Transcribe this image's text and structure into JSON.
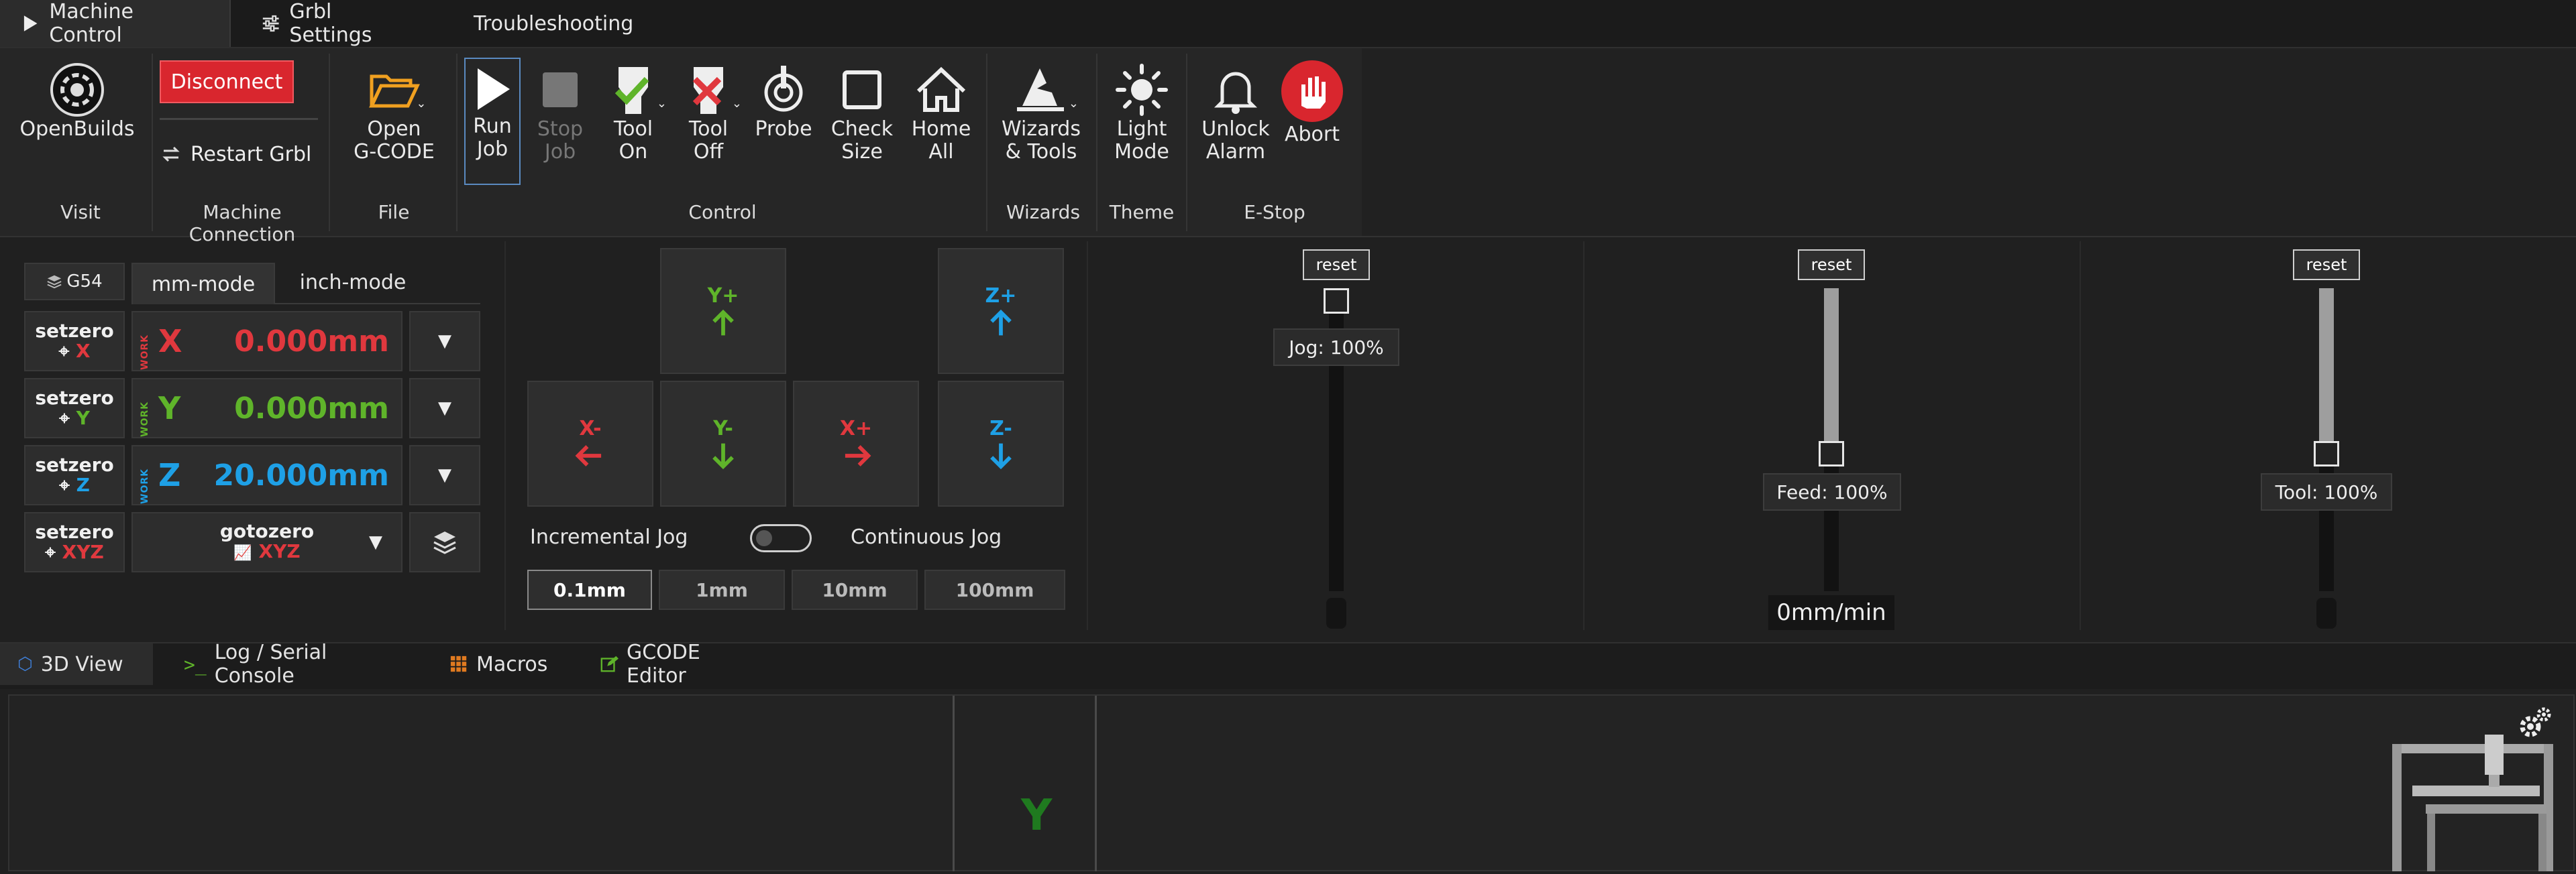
{
  "top_tabs": [
    {
      "label": "Machine Control",
      "icon": "play-icon"
    },
    {
      "label": "Grbl Settings",
      "icon": "sliders-icon"
    },
    {
      "label": "Troubleshooting",
      "icon": "document-icon"
    }
  ],
  "ribbon": {
    "openbuilds_label": "OpenBuilds",
    "disconnect_label": "Disconnect",
    "restart_label": "Restart Grbl",
    "open_gcode": [
      "Open",
      "G-CODE"
    ],
    "run_job": [
      "Run",
      "Job"
    ],
    "stop_job": [
      "Stop",
      "Job"
    ],
    "tool_on": [
      "Tool",
      "On"
    ],
    "tool_off": [
      "Tool",
      "Off"
    ],
    "probe": "Probe",
    "check_size": [
      "Check",
      "Size"
    ],
    "home_all": [
      "Home",
      "All"
    ],
    "wizards": [
      "Wizards",
      "& Tools"
    ],
    "light_mode": [
      "Light",
      "Mode"
    ],
    "unlock_alarm": [
      "Unlock",
      "Alarm"
    ],
    "abort": "Abort",
    "groups": {
      "visit": "Visit",
      "machine_connection": "Machine Connection",
      "file": "File",
      "control": "Control",
      "wizards": "Wizards",
      "theme": "Theme",
      "estop": "E-Stop"
    }
  },
  "dro": {
    "wcs_label": "G54",
    "mode_tabs": [
      "mm-mode",
      "inch-mode"
    ],
    "setzero_label": "setzero",
    "work_label": "WORK",
    "axes": [
      {
        "letter": "X",
        "value": "0.000mm",
        "setzero_axis": "X"
      },
      {
        "letter": "Y",
        "value": "0.000mm",
        "setzero_axis": "Y"
      },
      {
        "letter": "Z",
        "value": "20.000mm",
        "setzero_axis": "Z"
      }
    ],
    "setzero_xyz": "XYZ",
    "gotozero_label": "gotozero",
    "gotozero_axes": "XYZ"
  },
  "jog": {
    "y_plus": "Y+",
    "y_minus": "Y-",
    "x_plus": "X+",
    "x_minus": "X-",
    "z_plus": "Z+",
    "z_minus": "Z-",
    "incremental_label": "Incremental Jog",
    "continuous_label": "Continuous Jog",
    "steps": [
      "0.1mm",
      "1mm",
      "10mm",
      "100mm"
    ],
    "active_step": "0.1mm"
  },
  "sliders": {
    "reset_label": "reset",
    "jog_label": "Jog: 100%",
    "jog_level": 0,
    "feed_label": "Feed: 100%",
    "feed_level": 0.55,
    "feed_rate": "0mm/min",
    "tool_label": "Tool: 100%",
    "tool_level": 0.55
  },
  "bottom_tabs": [
    {
      "label": "3D View",
      "icon": "cube-icon"
    },
    {
      "label": "Log / Serial Console",
      "icon": "terminal-icon"
    },
    {
      "label": "Macros",
      "icon": "grid-icon"
    },
    {
      "label": "GCODE Editor",
      "icon": "edit-icon"
    }
  ],
  "viewer": {
    "axis_label": "Y"
  },
  "colors": {
    "x_axis": "#e0383e",
    "y_axis": "#5fb42a",
    "z_axis": "#1ea0e6",
    "accent_red": "#d9262e",
    "folder_orange": "#f0a020"
  }
}
